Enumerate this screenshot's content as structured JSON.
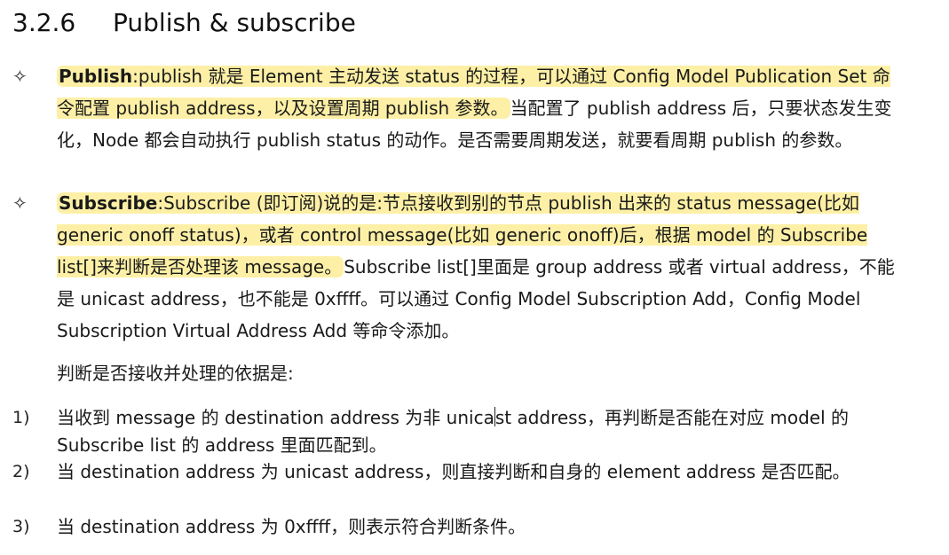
{
  "heading": {
    "number": "3.2.6",
    "title": "Publish & subscribe"
  },
  "bullet_symbol": "✧",
  "publish": {
    "term": "Publish",
    "sep": ":",
    "hl1": "publish 就是 Element 主动发送 status 的过程，可以通过 Config Model Publication Set 命令配置 publish address，以及设置周期 publish 参数。",
    "rest": "当配置了 publish address 后，只要状态发生变化，Node 都会自动执行 publish status 的动作。是否需要周期发送，就要看周期 publish 的参数。"
  },
  "subscribe": {
    "term": "Subscribe",
    "sep": ":",
    "hl1": "Subscribe (即订阅)说的是:节点接收到别的节点 publish 出来的 status message(比如 generic onoff status)，或者 control message(比如 generic onoff)后，根据 model 的 Subscribe list[]来判断是否处理该 message。",
    "rest": "Subscribe list[]里面是 group address 或者 virtual address，不能是 unicast address，也不能是 0xffff。可以通过 Config Model Subscription Add，Config Model Subscription Virtual Address Add 等命令添加。"
  },
  "criteria_intro": "判断是否接收并处理的依据是:",
  "list": [
    {
      "num": "1)",
      "text_a": "当收到 message 的 destination address 为非 unica",
      "text_b": "st address，再判断是否能在对应 model 的 Subscribe list 的 address 里面匹配到。"
    },
    {
      "num": "2)",
      "text_a": "当 destination address 为 unicast address，则直接判断和自身的 element address 是否匹配。",
      "text_b": ""
    },
    {
      "num": "3)",
      "text_a": "当 destination address 为 0xffff，则表示符合判断条件。",
      "text_b": ""
    }
  ]
}
